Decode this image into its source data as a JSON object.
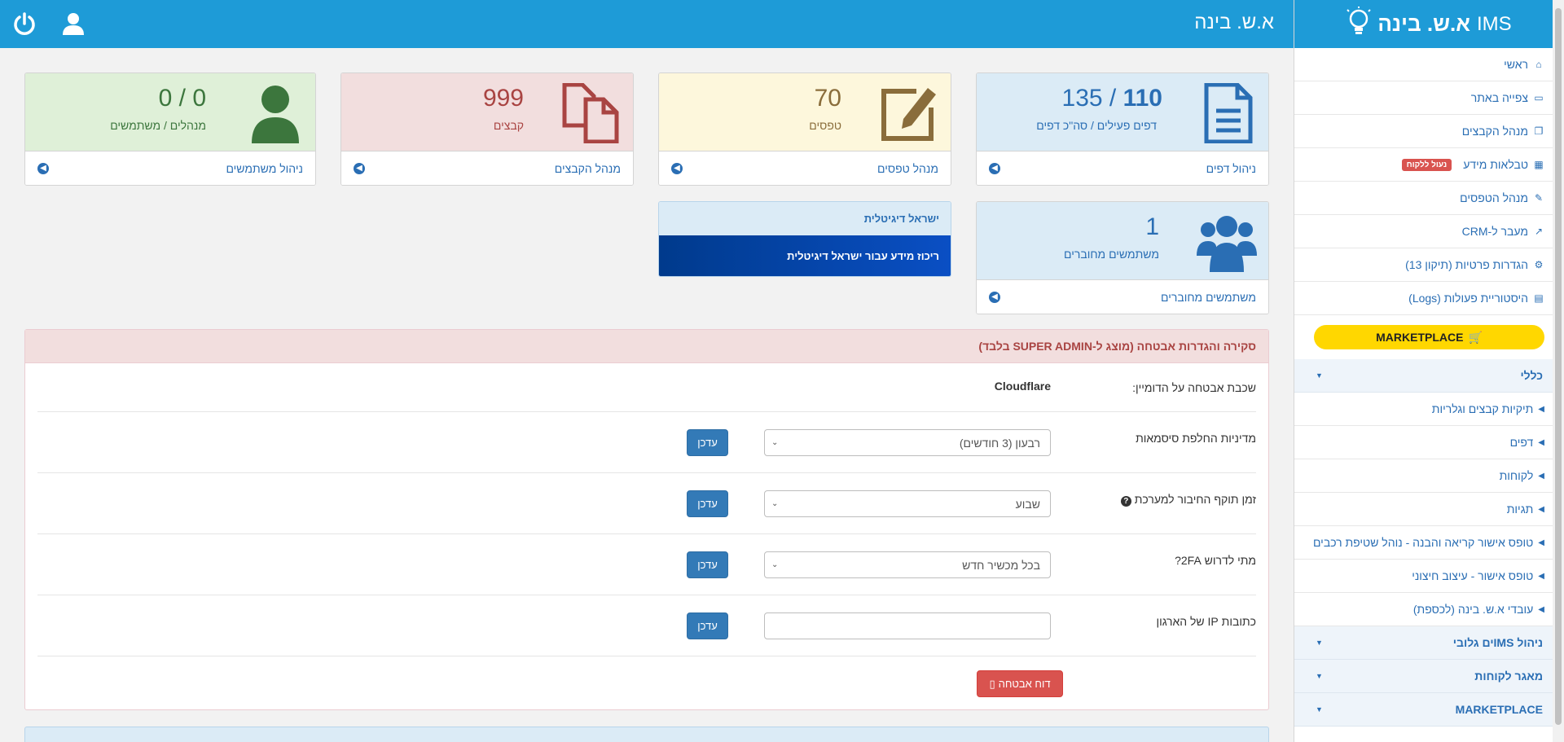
{
  "header": {
    "title": "א.ש. בינה"
  },
  "brand": {
    "name_he": "א.ש. בינה",
    "name_en": "IMS"
  },
  "sidebar": {
    "items": [
      {
        "label": "ראשי",
        "icon": "home-icon"
      },
      {
        "label": "צפייה באתר",
        "icon": "monitor-icon"
      },
      {
        "label": "מנהל הקבצים",
        "icon": "files-icon"
      },
      {
        "label": "טבלאות מידע",
        "icon": "table-icon",
        "badge": "נעול ללקוח"
      },
      {
        "label": "מנהל הטפסים",
        "icon": "edit-icon"
      },
      {
        "label": "מעבר ל-CRM",
        "icon": "external-link-icon"
      },
      {
        "label": "הגדרות פרטיות (תיקון 13)",
        "icon": "gear-icon"
      },
      {
        "label": "היסטוריית פעולות (Logs)",
        "icon": "archive-icon"
      }
    ],
    "marketplace_label": "MARKETPLACE",
    "group_general": "כללי",
    "sub_items": [
      "תיקיות קבצים וגלריות",
      "דפים",
      "לקוחות",
      "תגיות",
      "טופס אישור קריאה והבנה - נוהל שטיפת רכבים",
      "טופס אישור - עיצוב חיצוני",
      "עובדי א.ש. בינה (לכספת)"
    ],
    "groups": [
      "ניהול IMSים גלובי",
      "מאגר לקוחות",
      "MARKETPLACE"
    ]
  },
  "cards": {
    "pages": {
      "active": "110",
      "total": "135",
      "sep": " / ",
      "label": "דפים פעילים / סה\"כ דפים",
      "link": "ניהול דפים"
    },
    "forms": {
      "value": "70",
      "label": "טפסים",
      "link": "מנהל טפסים"
    },
    "files": {
      "value": "999",
      "label": "קבצים",
      "link": "מנהל הקבצים"
    },
    "users": {
      "value": "0 / 0",
      "label": "מנהלים / משתמשים",
      "link": "ניהול משתמשים"
    },
    "connected": {
      "value": "1",
      "label": "משתמשים מחוברים",
      "link": "משתמשים מחוברים"
    }
  },
  "digital": {
    "title": "ישראל דיגיטלית",
    "body": "ריכוז מידע עבור ישראל דיגיטלית"
  },
  "security": {
    "title": "סקירה והגדרות אבטחה (מוצג ל-SUPER ADMIN בלבד)",
    "domain_label": "שכבת אבטחה על הדומיין:",
    "domain_value": "Cloudflare",
    "password_label": "מדיניות החלפת סיסמאות",
    "password_value": "רבעון (3 חודשים)",
    "session_label": "זמן תוקף החיבור למערכת",
    "session_value": "שבוע",
    "twofa_label": "מתי לדרוש 2FA?",
    "twofa_value": "בכל מכשיר חדש",
    "ip_label": "כתובות IP של הארגון",
    "ip_value": "",
    "update_label": "עדכן",
    "report_label": "דוח אבטחה"
  }
}
